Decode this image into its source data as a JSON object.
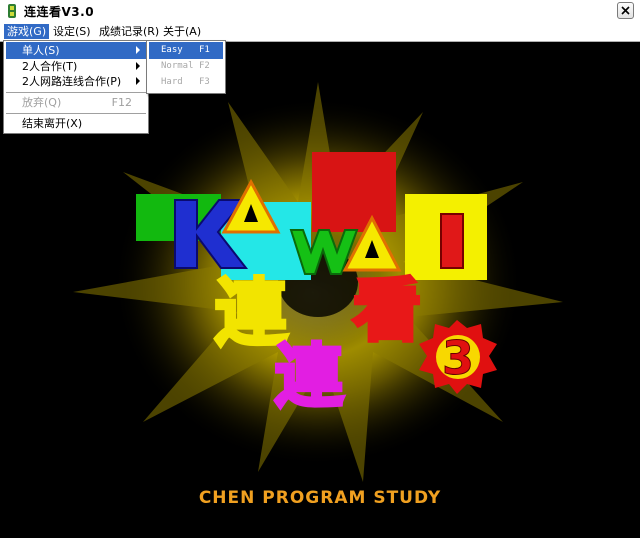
{
  "window": {
    "title": "连连看V3.0"
  },
  "menubar": {
    "items": [
      {
        "label": "游戏(G)"
      },
      {
        "label": "设定(S)"
      },
      {
        "label": "成绩记录(R)"
      },
      {
        "label": "关于(A)"
      }
    ]
  },
  "game_menu": {
    "items": [
      {
        "label": "单人(S)",
        "has_submenu": true
      },
      {
        "label": "2人合作(T)",
        "has_submenu": true
      },
      {
        "label": "2人网路连线合作(P)",
        "has_submenu": true
      },
      {
        "label": "放弃(Q)",
        "shortcut": "F12",
        "disabled": true
      },
      {
        "label": "结束离开(X)"
      }
    ]
  },
  "single_submenu": {
    "items": [
      {
        "label": "Easy",
        "shortcut": "F1"
      },
      {
        "label": "Normal",
        "shortcut": "F2",
        "disabled": true
      },
      {
        "label": "Hard",
        "shortcut": "F3",
        "disabled": true
      }
    ]
  },
  "splash": {
    "logo_letters": [
      "K",
      "A",
      "W",
      "A",
      "I"
    ],
    "chars": [
      "連",
      "連",
      "看",
      "3"
    ],
    "credit": "CHEN PROGRAM STUDY"
  },
  "colors": {
    "selection": "#316ac5",
    "credit": "#f0a020"
  }
}
